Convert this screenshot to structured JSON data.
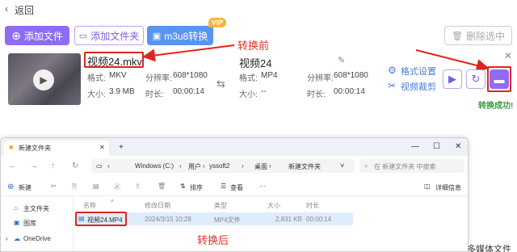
{
  "header": {
    "back_label": "返回"
  },
  "toolbar": {
    "add_file": "添加文件",
    "add_folder": "添加文件夹",
    "m3u8": "m3u8转换",
    "vip": "VIP",
    "delete_selected": "删除选中"
  },
  "task": {
    "source": {
      "name": "视频24.mkv",
      "format_label": "格式:",
      "format": "MKV",
      "resolution_label": "分辨率:",
      "resolution": "608*1080",
      "size_label": "大小:",
      "size": "3.9 MB",
      "duration_label": "时长:",
      "duration": "00:00:14"
    },
    "output": {
      "name": "视频24",
      "format_label": "格式:",
      "format": "MP4",
      "resolution_label": "分辨率:",
      "resolution": "608*1080",
      "size_label": "大小:",
      "size": "--",
      "duration_label": "时长:",
      "duration": "00:00:14"
    },
    "format_settings": "格式设置",
    "video_cut": "视频裁剪",
    "status": "转换成功!",
    "annotation_before": "转换前"
  },
  "explorer": {
    "tab_title": "新建文件夹",
    "window_controls": {
      "minimize": "—",
      "maximize": "☐",
      "close": "✕"
    },
    "breadcrumb": [
      "Windows (C:)",
      "用户",
      "yssoft2",
      "桌面",
      "新建文件夹"
    ],
    "search_placeholder": "在 新建文件夹 中搜索",
    "tools": {
      "new": "新建",
      "sort": "排序",
      "view": "查看",
      "details": "详细信息"
    },
    "columns": {
      "name": "名称",
      "date": "修改日期",
      "type": "类型",
      "size": "大小",
      "duration": "时长"
    },
    "file": {
      "name": "视频24.MP4",
      "date": "2024/3/15 10:28",
      "type": "MP4文件",
      "size": "2,831 KB",
      "duration": "00:00:14"
    },
    "sidebar": [
      "主文件夹",
      "图库",
      "OneDrive"
    ],
    "annotation_after": "转换后"
  },
  "footer_partial": "多媒体文件"
}
